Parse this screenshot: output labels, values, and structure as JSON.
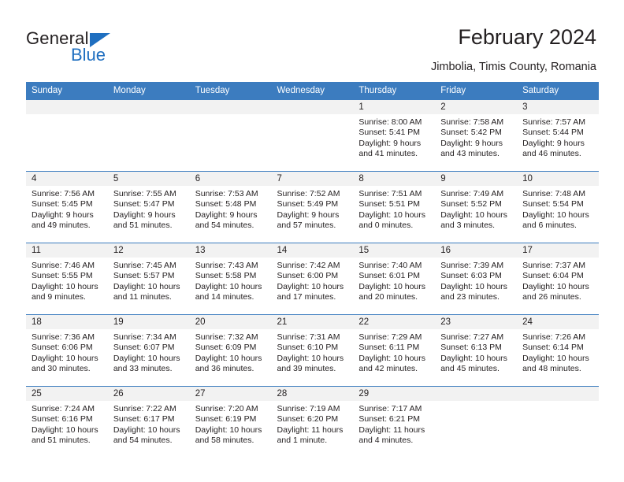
{
  "brand": {
    "name_primary": "General",
    "name_secondary": "Blue",
    "triangle_color": "#1f6fc0"
  },
  "header": {
    "title": "February 2024",
    "subtitle": "Jimbolia, Timis County, Romania",
    "accent_color": "#3c7cbf"
  },
  "weekdays": [
    "Sunday",
    "Monday",
    "Tuesday",
    "Wednesday",
    "Thursday",
    "Friday",
    "Saturday"
  ],
  "weeks": [
    [
      {
        "day": "",
        "empty": true
      },
      {
        "day": "",
        "empty": true
      },
      {
        "day": "",
        "empty": true
      },
      {
        "day": "",
        "empty": true
      },
      {
        "day": "1",
        "sunrise": "Sunrise: 8:00 AM",
        "sunset": "Sunset: 5:41 PM",
        "daylight_1": "Daylight: 9 hours",
        "daylight_2": "and 41 minutes."
      },
      {
        "day": "2",
        "sunrise": "Sunrise: 7:58 AM",
        "sunset": "Sunset: 5:42 PM",
        "daylight_1": "Daylight: 9 hours",
        "daylight_2": "and 43 minutes."
      },
      {
        "day": "3",
        "sunrise": "Sunrise: 7:57 AM",
        "sunset": "Sunset: 5:44 PM",
        "daylight_1": "Daylight: 9 hours",
        "daylight_2": "and 46 minutes."
      }
    ],
    [
      {
        "day": "4",
        "sunrise": "Sunrise: 7:56 AM",
        "sunset": "Sunset: 5:45 PM",
        "daylight_1": "Daylight: 9 hours",
        "daylight_2": "and 49 minutes."
      },
      {
        "day": "5",
        "sunrise": "Sunrise: 7:55 AM",
        "sunset": "Sunset: 5:47 PM",
        "daylight_1": "Daylight: 9 hours",
        "daylight_2": "and 51 minutes."
      },
      {
        "day": "6",
        "sunrise": "Sunrise: 7:53 AM",
        "sunset": "Sunset: 5:48 PM",
        "daylight_1": "Daylight: 9 hours",
        "daylight_2": "and 54 minutes."
      },
      {
        "day": "7",
        "sunrise": "Sunrise: 7:52 AM",
        "sunset": "Sunset: 5:49 PM",
        "daylight_1": "Daylight: 9 hours",
        "daylight_2": "and 57 minutes."
      },
      {
        "day": "8",
        "sunrise": "Sunrise: 7:51 AM",
        "sunset": "Sunset: 5:51 PM",
        "daylight_1": "Daylight: 10 hours",
        "daylight_2": "and 0 minutes."
      },
      {
        "day": "9",
        "sunrise": "Sunrise: 7:49 AM",
        "sunset": "Sunset: 5:52 PM",
        "daylight_1": "Daylight: 10 hours",
        "daylight_2": "and 3 minutes."
      },
      {
        "day": "10",
        "sunrise": "Sunrise: 7:48 AM",
        "sunset": "Sunset: 5:54 PM",
        "daylight_1": "Daylight: 10 hours",
        "daylight_2": "and 6 minutes."
      }
    ],
    [
      {
        "day": "11",
        "sunrise": "Sunrise: 7:46 AM",
        "sunset": "Sunset: 5:55 PM",
        "daylight_1": "Daylight: 10 hours",
        "daylight_2": "and 9 minutes."
      },
      {
        "day": "12",
        "sunrise": "Sunrise: 7:45 AM",
        "sunset": "Sunset: 5:57 PM",
        "daylight_1": "Daylight: 10 hours",
        "daylight_2": "and 11 minutes."
      },
      {
        "day": "13",
        "sunrise": "Sunrise: 7:43 AM",
        "sunset": "Sunset: 5:58 PM",
        "daylight_1": "Daylight: 10 hours",
        "daylight_2": "and 14 minutes."
      },
      {
        "day": "14",
        "sunrise": "Sunrise: 7:42 AM",
        "sunset": "Sunset: 6:00 PM",
        "daylight_1": "Daylight: 10 hours",
        "daylight_2": "and 17 minutes."
      },
      {
        "day": "15",
        "sunrise": "Sunrise: 7:40 AM",
        "sunset": "Sunset: 6:01 PM",
        "daylight_1": "Daylight: 10 hours",
        "daylight_2": "and 20 minutes."
      },
      {
        "day": "16",
        "sunrise": "Sunrise: 7:39 AM",
        "sunset": "Sunset: 6:03 PM",
        "daylight_1": "Daylight: 10 hours",
        "daylight_2": "and 23 minutes."
      },
      {
        "day": "17",
        "sunrise": "Sunrise: 7:37 AM",
        "sunset": "Sunset: 6:04 PM",
        "daylight_1": "Daylight: 10 hours",
        "daylight_2": "and 26 minutes."
      }
    ],
    [
      {
        "day": "18",
        "sunrise": "Sunrise: 7:36 AM",
        "sunset": "Sunset: 6:06 PM",
        "daylight_1": "Daylight: 10 hours",
        "daylight_2": "and 30 minutes."
      },
      {
        "day": "19",
        "sunrise": "Sunrise: 7:34 AM",
        "sunset": "Sunset: 6:07 PM",
        "daylight_1": "Daylight: 10 hours",
        "daylight_2": "and 33 minutes."
      },
      {
        "day": "20",
        "sunrise": "Sunrise: 7:32 AM",
        "sunset": "Sunset: 6:09 PM",
        "daylight_1": "Daylight: 10 hours",
        "daylight_2": "and 36 minutes."
      },
      {
        "day": "21",
        "sunrise": "Sunrise: 7:31 AM",
        "sunset": "Sunset: 6:10 PM",
        "daylight_1": "Daylight: 10 hours",
        "daylight_2": "and 39 minutes."
      },
      {
        "day": "22",
        "sunrise": "Sunrise: 7:29 AM",
        "sunset": "Sunset: 6:11 PM",
        "daylight_1": "Daylight: 10 hours",
        "daylight_2": "and 42 minutes."
      },
      {
        "day": "23",
        "sunrise": "Sunrise: 7:27 AM",
        "sunset": "Sunset: 6:13 PM",
        "daylight_1": "Daylight: 10 hours",
        "daylight_2": "and 45 minutes."
      },
      {
        "day": "24",
        "sunrise": "Sunrise: 7:26 AM",
        "sunset": "Sunset: 6:14 PM",
        "daylight_1": "Daylight: 10 hours",
        "daylight_2": "and 48 minutes."
      }
    ],
    [
      {
        "day": "25",
        "sunrise": "Sunrise: 7:24 AM",
        "sunset": "Sunset: 6:16 PM",
        "daylight_1": "Daylight: 10 hours",
        "daylight_2": "and 51 minutes."
      },
      {
        "day": "26",
        "sunrise": "Sunrise: 7:22 AM",
        "sunset": "Sunset: 6:17 PM",
        "daylight_1": "Daylight: 10 hours",
        "daylight_2": "and 54 minutes."
      },
      {
        "day": "27",
        "sunrise": "Sunrise: 7:20 AM",
        "sunset": "Sunset: 6:19 PM",
        "daylight_1": "Daylight: 10 hours",
        "daylight_2": "and 58 minutes."
      },
      {
        "day": "28",
        "sunrise": "Sunrise: 7:19 AM",
        "sunset": "Sunset: 6:20 PM",
        "daylight_1": "Daylight: 11 hours",
        "daylight_2": "and 1 minute."
      },
      {
        "day": "29",
        "sunrise": "Sunrise: 7:17 AM",
        "sunset": "Sunset: 6:21 PM",
        "daylight_1": "Daylight: 11 hours",
        "daylight_2": "and 4 minutes."
      },
      {
        "day": "",
        "empty": true
      },
      {
        "day": "",
        "empty": true
      }
    ]
  ]
}
